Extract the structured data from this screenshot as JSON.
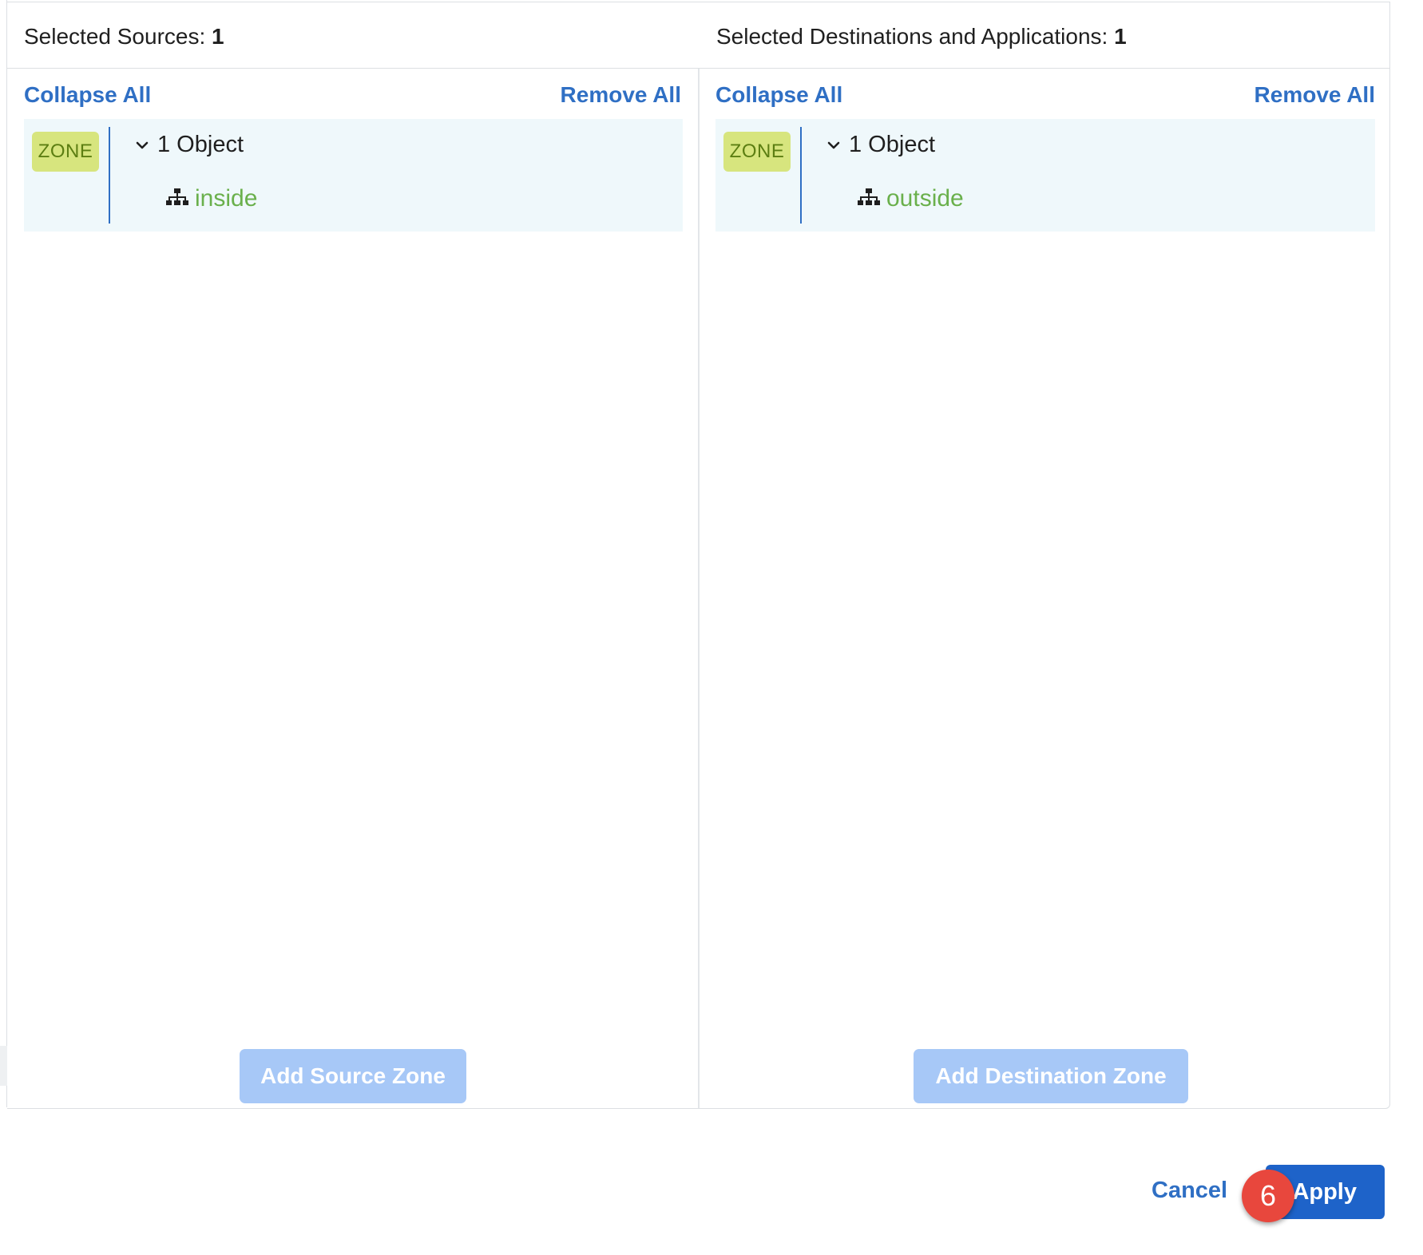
{
  "header": {
    "sources_label": "Selected Sources:",
    "sources_count": "1",
    "destinations_label": "Selected Destinations and Applications:",
    "destinations_count": "1"
  },
  "sources": {
    "collapse_all": "Collapse All",
    "remove_all": "Remove All",
    "badge": "ZONE",
    "object_count": "1 Object",
    "item": "inside",
    "add_button": "Add Source Zone"
  },
  "destinations": {
    "collapse_all": "Collapse All",
    "remove_all": "Remove All",
    "badge": "ZONE",
    "object_count": "1 Object",
    "item": "outside",
    "add_button": "Add Destination Zone"
  },
  "footer": {
    "cancel": "Cancel",
    "apply": "Apply",
    "step_number": "6"
  },
  "icons": {
    "chevron": "chevron-down-icon",
    "zone_item": "network-hierarchy-icon"
  },
  "colors": {
    "link": "#2f6fc4",
    "zone_badge_bg": "#d7e57e",
    "zone_badge_text": "#5c7e12",
    "zone_name": "#6ab04c",
    "group_bg": "#eff8fb",
    "add_button_bg": "#a7c8f7",
    "apply_bg": "#1e63c9",
    "step_badge_bg": "#e8473d"
  }
}
